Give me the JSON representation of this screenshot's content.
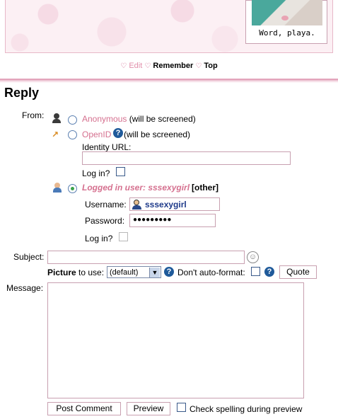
{
  "banner": {
    "caption": "Word, playa."
  },
  "nav": {
    "edit": "Edit",
    "remember": "Remember",
    "top": "Top"
  },
  "reply": {
    "heading": "Reply",
    "from_label": "From:",
    "anonymous": {
      "label": "Anonymous",
      "note": "(will be screened)"
    },
    "openid": {
      "label": "OpenID",
      "note": "(will be screened)",
      "identity_label": "Identity URL:",
      "identity_value": "",
      "login_label": "Log in?"
    },
    "logged_in": {
      "label": "Logged in user: sssexygirl",
      "other": "[other]"
    },
    "username_label": "Username:",
    "username_value": "sssexygirl",
    "password_label": "Password:",
    "password_value": "●●●●●●●●●",
    "login_label": "Log in?",
    "subject_label": "Subject:",
    "subject_value": "",
    "picture_label_bold": "Picture",
    "picture_label_rest": "to use:",
    "picture_value": "(default)",
    "autoformat_label": "Don't auto-format:",
    "quote_button": "Quote",
    "message_label": "Message:",
    "message_value": "",
    "post_button": "Post Comment",
    "preview_button": "Preview",
    "spellcheck_label": "Check spelling during preview"
  }
}
